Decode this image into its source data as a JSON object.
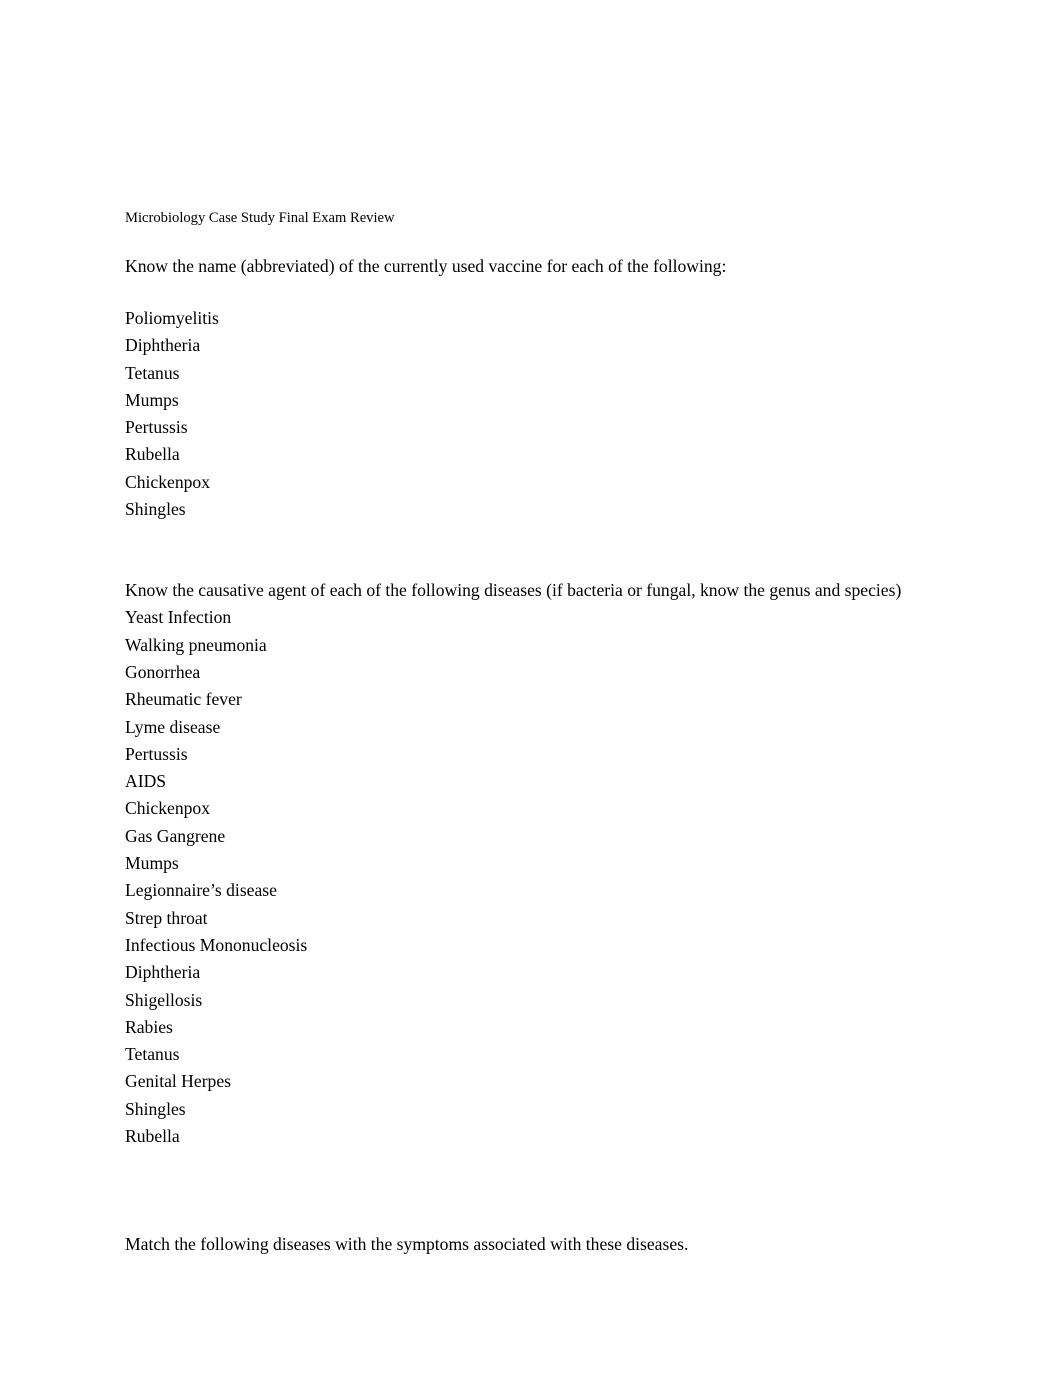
{
  "document": {
    "title": "Microbiology Case Study Final Exam Review",
    "background_color": "#ffffff",
    "text_color": "#000000"
  },
  "sections": {
    "vaccines": {
      "heading": "Know the name (abbreviated) of the currently used vaccine for each of the following:",
      "items": [
        "Poliomyelitis",
        "Diphtheria",
        "Tetanus",
        "Mumps",
        "Pertussis",
        "Rubella",
        "Chickenpox",
        "Shingles"
      ]
    },
    "causative_agents": {
      "heading": "Know the causative agent of each of the following diseases (if bacteria or fungal, know the genus and species)",
      "items": [
        "Yeast Infection",
        "Walking pneumonia",
        "Gonorrhea",
        "Rheumatic fever",
        "Lyme disease",
        "Pertussis",
        "AIDS",
        "Chickenpox",
        "Gas Gangrene",
        "Mumps",
        "Legionnaire’s disease",
        "Strep throat",
        "Infectious Mononucleosis",
        "Diphtheria",
        "Shigellosis",
        "Rabies",
        "Tetanus",
        "Genital Herpes",
        "Shingles",
        "Rubella"
      ]
    },
    "matching": {
      "heading": "Match the following diseases with the symptoms associated with these diseases."
    }
  }
}
